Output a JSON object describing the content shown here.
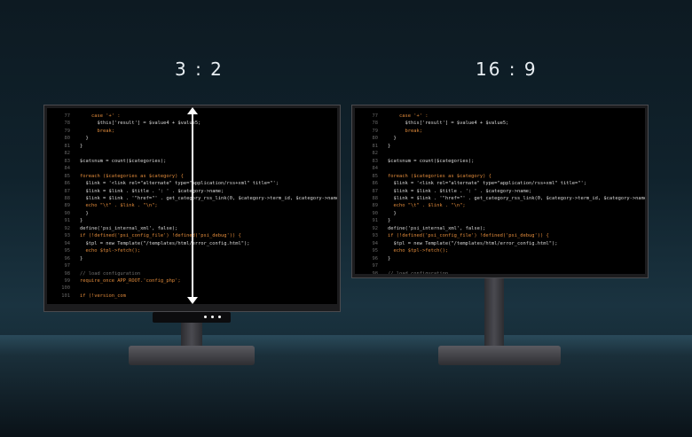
{
  "labels": {
    "left_ratio": "3 : 2",
    "right_ratio": "16 : 9"
  },
  "code_left": [
    {
      "n": "77",
      "t": "    case '+' :"
    },
    {
      "n": "78",
      "t": "      $this['result'] = $value4 + $value5;"
    },
    {
      "n": "79",
      "t": "      break;"
    },
    {
      "n": "80",
      "t": "  }"
    },
    {
      "n": "81",
      "t": "}"
    },
    {
      "n": "82",
      "t": ""
    },
    {
      "n": "83",
      "t": "$catsnum = count($categories);"
    },
    {
      "n": "84",
      "t": ""
    },
    {
      "n": "85",
      "t": "foreach ($categories as $category) {"
    },
    {
      "n": "86",
      "t": "  $link = '<link rel=\"alternate\" type=\"application/rss+xml\" title=\"';"
    },
    {
      "n": "87",
      "t": "  $link = $link . $title . ': ' . $category->name;"
    },
    {
      "n": "88",
      "t": "  $link = $link . '\"href=\"' . get_category_rss_link(0, $category->term_id, $category->name);"
    },
    {
      "n": "89",
      "t": "  echo \"\\t\" . $link . \"\\n\";"
    },
    {
      "n": "90",
      "t": "  }"
    },
    {
      "n": "91",
      "t": "}"
    },
    {
      "n": "92",
      "t": "define('psi_internal_xml', false);"
    },
    {
      "n": "93",
      "t": "if (!defined('psi_config_file') !defined('psi_debug')) {"
    },
    {
      "n": "94",
      "t": "  $tpl = new Template(\"/templates/html/error_config.html\");"
    },
    {
      "n": "95",
      "t": "  echo $tpl->fetch();"
    },
    {
      "n": "96",
      "t": "}"
    },
    {
      "n": "97",
      "t": ""
    },
    {
      "n": "98",
      "t": "// load configuration"
    },
    {
      "n": "99",
      "t": "require_once APP_ROOT.'config_php';"
    },
    {
      "n": "100",
      "t": ""
    },
    {
      "n": "101",
      "t": "if (!version_com"
    }
  ],
  "code_right": [
    {
      "n": "77",
      "t": "    case '+' :"
    },
    {
      "n": "78",
      "t": "      $this['result'] = $value4 + $value5;"
    },
    {
      "n": "79",
      "t": "      break;"
    },
    {
      "n": "80",
      "t": "  }"
    },
    {
      "n": "81",
      "t": "}"
    },
    {
      "n": "82",
      "t": ""
    },
    {
      "n": "83",
      "t": "$catsnum = count($categories);"
    },
    {
      "n": "84",
      "t": ""
    },
    {
      "n": "85",
      "t": "foreach ($categories as $category) {"
    },
    {
      "n": "86",
      "t": "  $link = '<link rel=\"alternate\" type=\"application/rss+xml\" title=\"';"
    },
    {
      "n": "87",
      "t": "  $link = $link . $title . ': ' . $category->name;"
    },
    {
      "n": "88",
      "t": "  $link = $link . '\"href=\"' . get_category_rss_link(0, $category->term_id, $category->name);"
    },
    {
      "n": "89",
      "t": "  echo \"\\t\" . $link . \"\\n\";"
    },
    {
      "n": "90",
      "t": "  }"
    },
    {
      "n": "91",
      "t": "}"
    },
    {
      "n": "92",
      "t": "define('psi_internal_xml', false);"
    },
    {
      "n": "93",
      "t": "if (!defined('psi_config_file') !defined('psi_debug')) {"
    },
    {
      "n": "94",
      "t": "  $tpl = new Template(\"/templates/html/error_config.html\");"
    },
    {
      "n": "95",
      "t": "  echo $tpl->fetch();"
    },
    {
      "n": "96",
      "t": "}"
    },
    {
      "n": "97",
      "t": ""
    },
    {
      "n": "98",
      "t": "// load configuration"
    }
  ],
  "colors": {
    "keyword": "#e08a3a",
    "string": "#c9b36a",
    "comment": "#707070"
  }
}
